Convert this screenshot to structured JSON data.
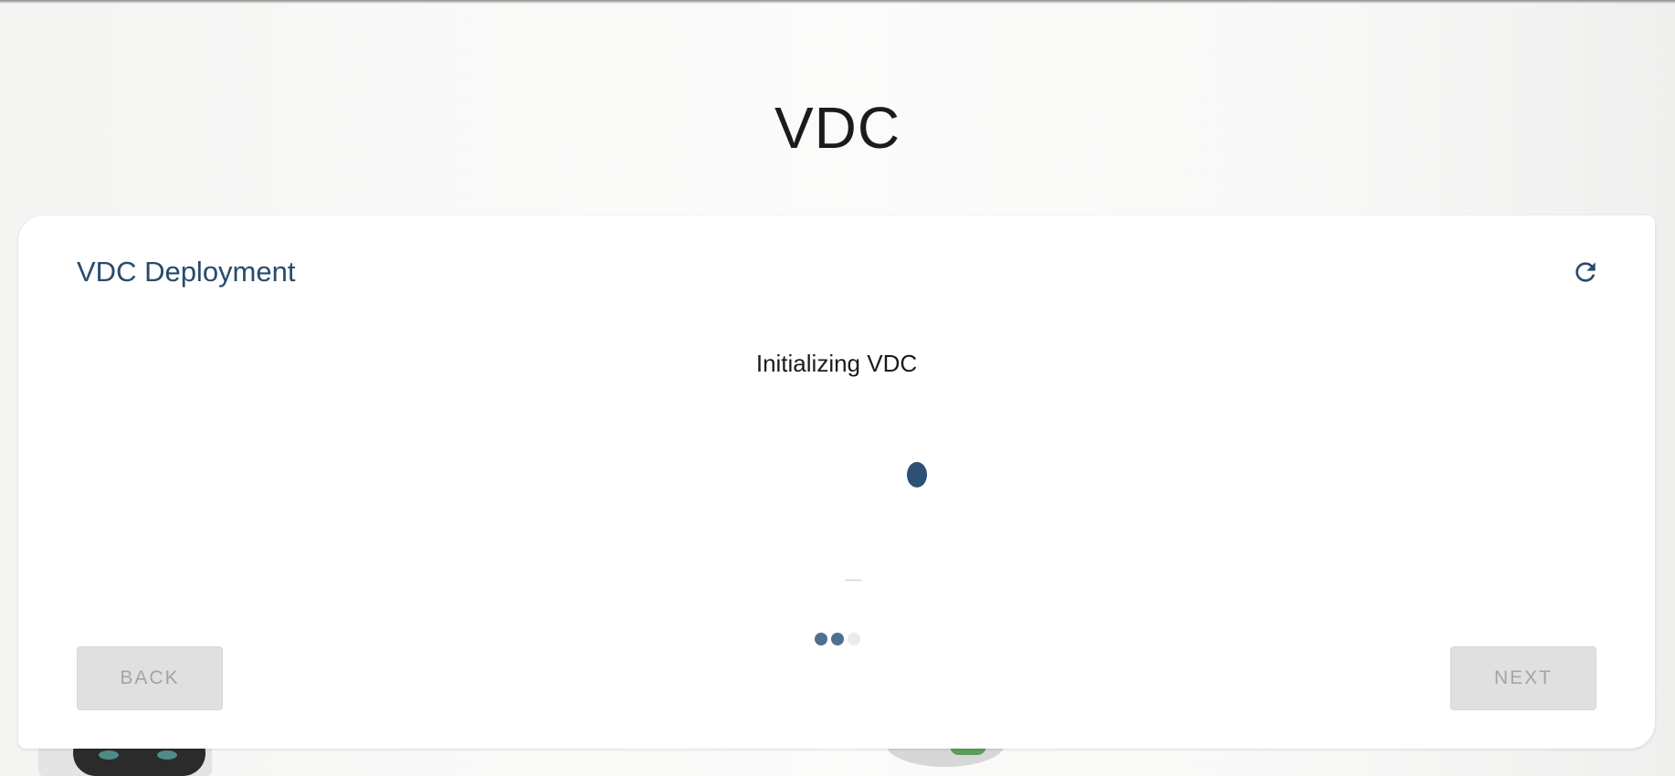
{
  "page": {
    "title": "VDC"
  },
  "card": {
    "title": "VDC Deployment",
    "status_text": "Initializing VDC",
    "refresh_icon": "refresh-icon"
  },
  "stepper": {
    "total_steps": 3,
    "completed_steps": 2
  },
  "buttons": {
    "back_label": "BACK",
    "next_label": "NEXT",
    "back_disabled": true,
    "next_disabled": true
  },
  "colors": {
    "accent": "#274b6d",
    "spinner": "#2d5075",
    "button_bg": "#e0e0e0",
    "button_text": "#a4a4a4"
  }
}
